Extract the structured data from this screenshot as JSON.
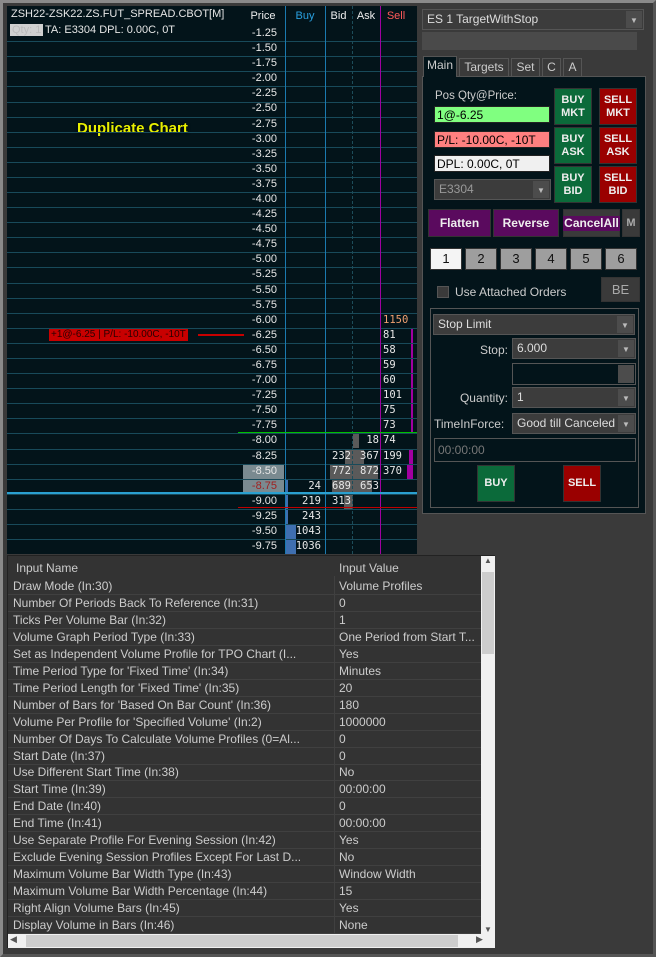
{
  "chart": {
    "symbol": "ZSH22-ZSK22.ZS.FUT_SPREAD.CBOT[M]",
    "qty_label": "Qty: 1",
    "account_info": "TA: E3304  DPL: 0.00C, 0T",
    "watermark": "Duplicate Chart",
    "position_marker": "+1@-6.25 | P/L: -10.00C, -10T",
    "headers": {
      "price": "Price",
      "buy": "Buy",
      "bid": "Bid",
      "ask": "Ask",
      "sell": "Sell"
    },
    "ladder": [
      {
        "price": "-1.25"
      },
      {
        "price": "-1.50"
      },
      {
        "price": "-1.75"
      },
      {
        "price": "-2.00"
      },
      {
        "price": "-2.25"
      },
      {
        "price": "-2.50"
      },
      {
        "price": "-2.75"
      },
      {
        "price": "-3.00"
      },
      {
        "price": "-3.25"
      },
      {
        "price": "-3.50"
      },
      {
        "price": "-3.75"
      },
      {
        "price": "-4.00"
      },
      {
        "price": "-4.25"
      },
      {
        "price": "-4.50"
      },
      {
        "price": "-4.75"
      },
      {
        "price": "-5.00"
      },
      {
        "price": "-5.25"
      },
      {
        "price": "-5.50"
      },
      {
        "price": "-5.75"
      },
      {
        "price": "-6.00",
        "sell": "1150"
      },
      {
        "price": "-6.25",
        "sell": "81"
      },
      {
        "price": "-6.50",
        "sell": "58"
      },
      {
        "price": "-6.75",
        "sell": "59"
      },
      {
        "price": "-7.00",
        "sell": "60"
      },
      {
        "price": "-7.25",
        "sell": "101"
      },
      {
        "price": "-7.50",
        "sell": "75"
      },
      {
        "price": "-7.75",
        "sell": "73"
      },
      {
        "price": "-8.00",
        "ask": "18",
        "sell": "74"
      },
      {
        "price": "-8.25",
        "bid": "232",
        "ask": "367",
        "sell": "199"
      },
      {
        "price": "-8.50",
        "bid": "772",
        "ask": "872",
        "sell": "370"
      },
      {
        "price": "-8.75",
        "buy": "24",
        "bid": "689",
        "ask": "653"
      },
      {
        "price": "-9.00",
        "buy": "219",
        "bid": "313"
      },
      {
        "price": "-9.25",
        "buy": "243"
      },
      {
        "price": "-9.50",
        "buy": "1043"
      },
      {
        "price": "-9.75",
        "buy": "1036"
      }
    ]
  },
  "panel": {
    "strategy": "ES 1 TargetWithStop",
    "tabs": [
      "Main",
      "Targets",
      "Set",
      "C",
      "A"
    ],
    "pos_label": "Pos Qty@Price:",
    "pos_value": "1@-6.25",
    "pl_value": "P/L: -10.00C, -10T",
    "dpl_value": "DPL: 0.00C, 0T",
    "account": "E3304",
    "buy_mkt": "BUY MKT",
    "sell_mkt": "SELL MKT",
    "buy_ask": "BUY ASK",
    "sell_ask": "SELL ASK",
    "buy_bid": "BUY BID",
    "sell_bid": "SELL BID",
    "flatten": "Flatten",
    "reverse": "Reverse",
    "cancel_all": "CancelAll",
    "m": "M",
    "qty_presets": [
      "1",
      "2",
      "3",
      "4",
      "5",
      "6"
    ],
    "use_attached": "Use Attached Orders",
    "be": "BE",
    "order_type": "Stop Limit",
    "stop_label": "Stop:",
    "stop_value": "6.000",
    "quantity_label": "Quantity:",
    "quantity_value": "1",
    "tif_label": "TimeInForce:",
    "tif_value": "Good till Canceled",
    "time_value": "00:00:00",
    "buy": "BUY",
    "sell": "SELL"
  },
  "inputs": {
    "col_name": "Input Name",
    "col_value": "Input Value",
    "rows": [
      [
        "Draw Mode   (In:30)",
        "Volume Profiles"
      ],
      [
        "Number Of Periods Back To Reference   (In:31)",
        "0"
      ],
      [
        "Ticks Per Volume Bar   (In:32)",
        "1"
      ],
      [
        "Volume Graph Period Type   (In:33)",
        "One Period from Start T..."
      ],
      [
        "Set as Independent Volume Profile for TPO Chart   (I...",
        "Yes"
      ],
      [
        "Time Period Type for 'Fixed Time'   (In:34)",
        "Minutes"
      ],
      [
        "Time Period Length for 'Fixed Time'   (In:35)",
        "20"
      ],
      [
        "Number of Bars for 'Based On Bar Count'   (In:36)",
        "180"
      ],
      [
        "Volume Per Profile for 'Specified Volume'   (In:2)",
        "1000000"
      ],
      [
        "Number Of Days To Calculate Volume Profiles (0=Al...",
        "0"
      ],
      [
        "Start Date   (In:37)",
        "0"
      ],
      [
        "Use Different Start Time   (In:38)",
        "No"
      ],
      [
        "Start Time   (In:39)",
        "00:00:00"
      ],
      [
        "End Date   (In:40)",
        "0"
      ],
      [
        "End Time   (In:41)",
        "00:00:00"
      ],
      [
        "Use Separate Profile For Evening Session   (In:42)",
        "Yes"
      ],
      [
        "Exclude Evening Session Profiles Except For Last D...",
        "No"
      ],
      [
        "Maximum Volume Bar Width Type   (In:43)",
        "Window Width"
      ],
      [
        "Maximum Volume Bar Width Percentage   (In:44)",
        "15"
      ],
      [
        "Right Align Volume Bars   (In:45)",
        "Yes"
      ],
      [
        "Display Volume in Bars   (In:46)",
        "None"
      ]
    ]
  }
}
